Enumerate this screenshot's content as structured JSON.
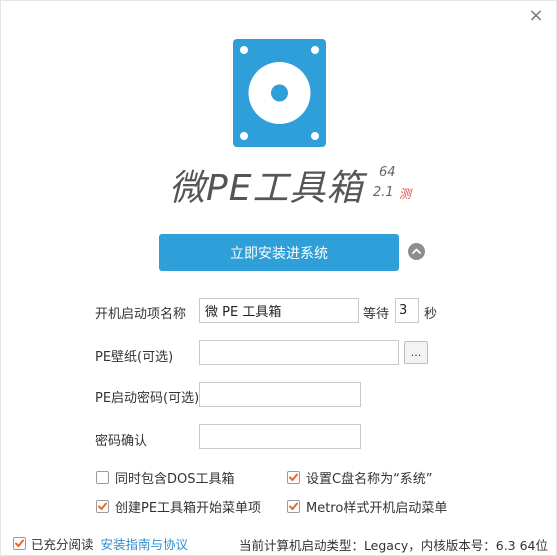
{
  "window": {
    "close_glyph": "×"
  },
  "logo": {
    "name": "disc-drive-logo",
    "color": "#2e9fd8"
  },
  "brand": {
    "title": "微PE工具箱",
    "arch": "64",
    "version": "2.1",
    "tag": "测"
  },
  "install_button": {
    "label": "立即安装进系统"
  },
  "expand_icon": "chevron-up-icon",
  "boot_name": {
    "label": "开机启动项名称",
    "value": "微 PE 工具箱"
  },
  "wait": {
    "label": "等待",
    "value": "3",
    "unit": "秒"
  },
  "wallpaper": {
    "label": "PE壁纸(可选)",
    "value": "",
    "browse_label": "..."
  },
  "password": {
    "label": "PE启动密码(可选)",
    "value": ""
  },
  "password_confirm": {
    "label": "密码确认",
    "value": ""
  },
  "options": [
    {
      "label": "同时包含DOS工具箱",
      "checked": false
    },
    {
      "label": "设置C盘名称为“系统”",
      "checked": true
    },
    {
      "label": "创建PE工具箱开始菜单项",
      "checked": true
    },
    {
      "label": "Metro样式开机启动菜单",
      "checked": true
    }
  ],
  "footer": {
    "agree_label": "已充分阅读",
    "agree_checked": true,
    "guide_link": "安装指南与协议",
    "status": "当前计算机启动类型：Legacy，内核版本号：6.3 64位"
  },
  "colors": {
    "accent": "#2e9fd8",
    "check": "#e8672b",
    "link": "#2e8fd0",
    "beta_tag": "#d9534f"
  }
}
